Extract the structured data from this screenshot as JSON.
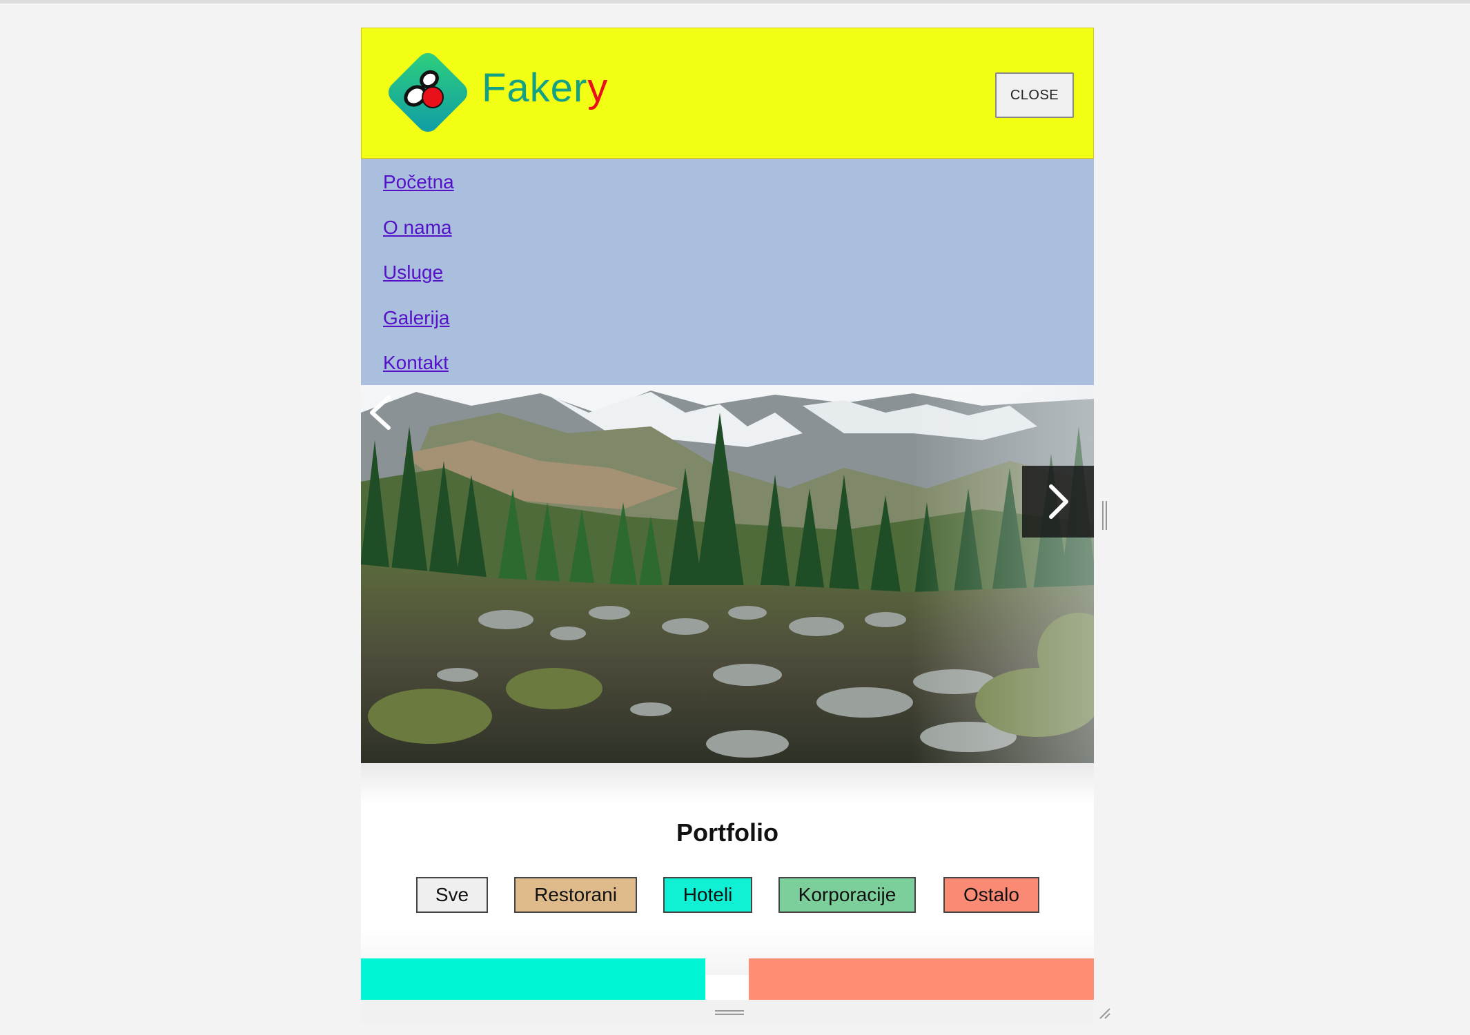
{
  "brand": {
    "name_main": "Faker",
    "name_accent": "y",
    "primary_color": "#14a085",
    "accent_color": "#e8101a",
    "header_bg": "#f2ff14"
  },
  "header": {
    "close_label": "CLOSE"
  },
  "nav": {
    "bg": "#aabfdd",
    "link_color": "#5510c8",
    "items": [
      {
        "label": "Početna"
      },
      {
        "label": "O nama"
      },
      {
        "label": "Usluge"
      },
      {
        "label": "Galerija"
      },
      {
        "label": "Kontakt"
      }
    ]
  },
  "slider": {
    "prev_icon": "chevron-left-icon",
    "next_icon": "chevron-right-icon"
  },
  "portfolio": {
    "title": "Portfolio",
    "filters": [
      {
        "label": "Sve",
        "color": "#efefef"
      },
      {
        "label": "Restorani",
        "color": "#dfba8b"
      },
      {
        "label": "Hoteli",
        "color": "#10f0d5"
      },
      {
        "label": "Korporacije",
        "color": "#7ccf9a"
      },
      {
        "label": "Ostalo",
        "color": "#fb8a74"
      }
    ],
    "tiles": [
      {
        "color": "#00f5d4"
      },
      {
        "color": "#ff8c75"
      }
    ]
  }
}
